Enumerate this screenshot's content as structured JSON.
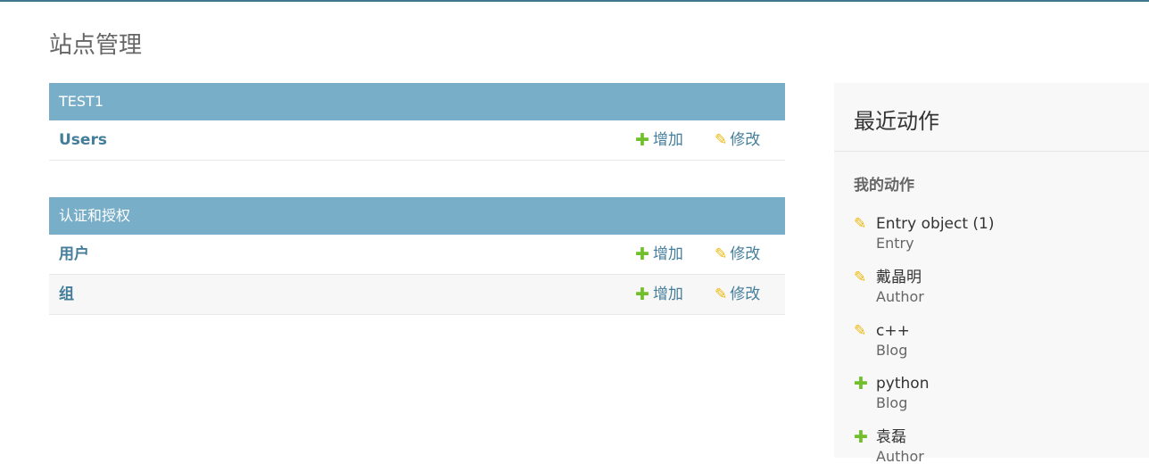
{
  "page": {
    "title": "站点管理"
  },
  "modules": [
    {
      "caption": "TEST1",
      "rows": [
        {
          "name": "Users",
          "add_label": "增加",
          "change_label": "修改"
        }
      ]
    },
    {
      "caption": "认证和授权",
      "rows": [
        {
          "name": "用户",
          "add_label": "增加",
          "change_label": "修改"
        },
        {
          "name": "组",
          "add_label": "增加",
          "change_label": "修改"
        }
      ]
    }
  ],
  "recent_actions": {
    "title": "最近动作",
    "subtitle": "我的动作",
    "items": [
      {
        "icon": "pencil-icon",
        "title": "Entry object (1)",
        "type": "Entry"
      },
      {
        "icon": "pencil-icon",
        "title": "戴晶明",
        "type": "Author"
      },
      {
        "icon": "pencil-icon",
        "title": "c++",
        "type": "Blog"
      },
      {
        "icon": "plus-icon",
        "title": "python",
        "type": "Blog"
      },
      {
        "icon": "plus-icon",
        "title": "袁磊",
        "type": "Author"
      }
    ]
  },
  "colors": {
    "header_bar": "#417690",
    "caption_bg": "#79aec8",
    "link": "#447e9b",
    "add_icon": "#70bf2b",
    "change_icon": "#efb80b"
  }
}
